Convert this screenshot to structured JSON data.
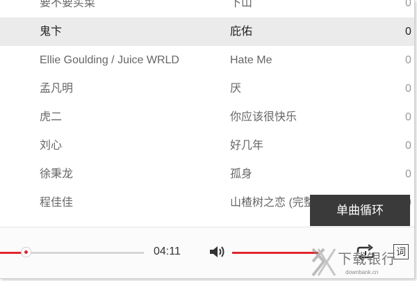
{
  "playlist": [
    {
      "artist": "要不要买菜",
      "song": "下山",
      "duration": "0"
    },
    {
      "artist": "鬼卞",
      "song": "庇佑",
      "duration": "0"
    },
    {
      "artist": "Ellie Goulding / Juice WRLD",
      "song": "Hate Me",
      "duration": "0"
    },
    {
      "artist": "孟凡明",
      "song": "厌",
      "duration": "0"
    },
    {
      "artist": "虎二",
      "song": "你应该很快乐",
      "duration": "0"
    },
    {
      "artist": "刘心",
      "song": "好几年",
      "duration": "0"
    },
    {
      "artist": "徐秉龙",
      "song": "孤身",
      "duration": "0"
    },
    {
      "artist": "程佳佳",
      "song": "山楂树之恋 (完整版)",
      "duration": "0"
    }
  ],
  "tooltip": "单曲循环",
  "player": {
    "time": "04:11",
    "progress_percent": 18,
    "volume_percent": 100,
    "lyric_label": "词",
    "volume_icon": "volume-icon",
    "loop_icon": "single-loop-icon"
  },
  "watermark": {
    "text": "下载银行",
    "sub": "downbank.cn"
  },
  "colors": {
    "accent": "#e0262d",
    "active_row": "#ebebeb",
    "tooltip_bg": "#3a3a3a"
  }
}
